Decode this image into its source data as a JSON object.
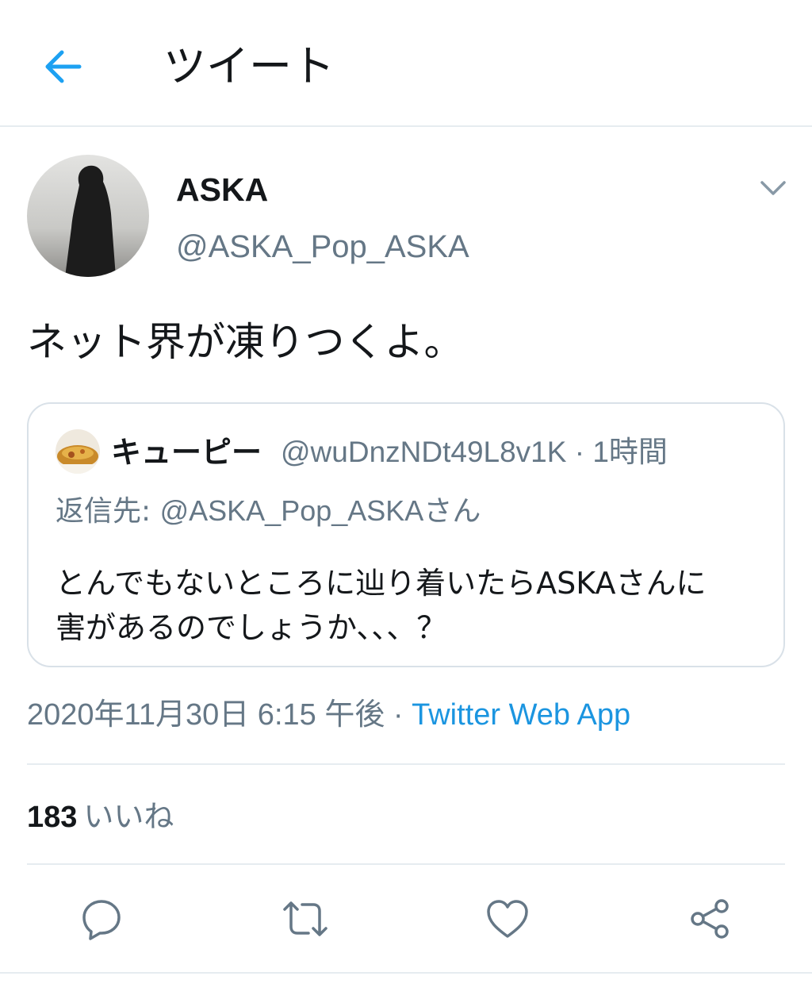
{
  "header": {
    "title": "ツイート",
    "back_icon": "arrow-left-icon"
  },
  "tweet": {
    "display_name": "ASKA",
    "handle": "@ASKA_Pop_ASKA",
    "text": "ネット界が凍りつくよ。",
    "menu_icon": "chevron-down-icon",
    "timestamp": "2020年11月30日 6:15 午後",
    "separator": " · ",
    "source": "Twitter Web App",
    "likes_count": "183",
    "likes_label": "いいね"
  },
  "quoted": {
    "display_name": "キューピー",
    "handle": "@wuDnzNDt49L8v1K",
    "time": "· 1時間",
    "reply_label": "返信先: ",
    "reply_to": "@ASKA_Pop_ASKAさん",
    "text_line1": "とんでもないところに辿り着いたらASKAさんに",
    "text_line2": "害があるのでしょうか、、、？"
  },
  "actions": [
    "reply-icon",
    "retweet-icon",
    "like-icon",
    "share-icon"
  ],
  "colors": {
    "accent": "#1da1f2",
    "link": "#1b95e0",
    "secondary_text": "#657786",
    "divider": "#e6ecf0"
  }
}
